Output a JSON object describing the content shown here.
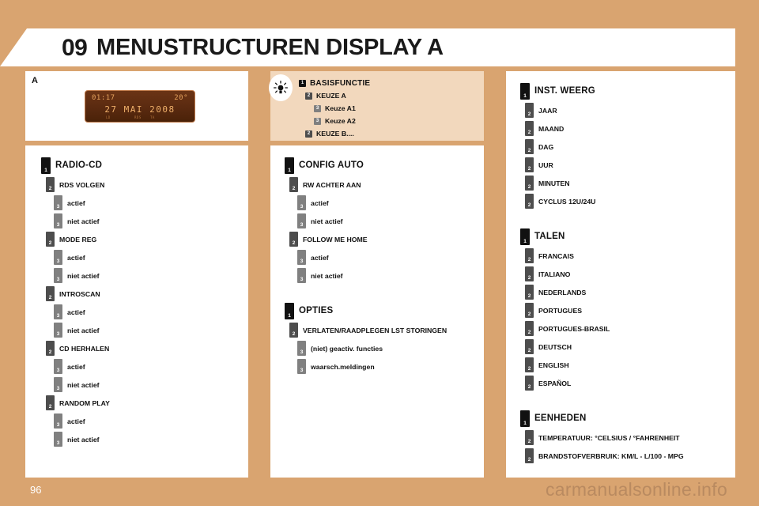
{
  "header": {
    "chapter_number": "09",
    "title": "MENUSTRUCTUREN DISPLAY A"
  },
  "footer": {
    "page_number": "96",
    "watermark": "carmanualsonline.info"
  },
  "display_panel": {
    "letter": "A",
    "lcd": {
      "time": "01:17",
      "temperature": "20°",
      "date": "27 MAI 2008",
      "indicator_1": "LD",
      "indicator_2": "RDS",
      "indicator_3": "TA"
    }
  },
  "legend": {
    "icon": "light-bulb-icon",
    "items": [
      {
        "level": 1,
        "label": "BASISFUNCTIE"
      },
      {
        "level": 2,
        "label": "KEUZE A"
      },
      {
        "level": 3,
        "label": "Keuze A1"
      },
      {
        "level": 3,
        "label": "Keuze A2"
      },
      {
        "level": 2,
        "label": "KEUZE B...."
      }
    ]
  },
  "columns": {
    "left": {
      "sections": [
        {
          "title": "RADIO-CD",
          "items": [
            {
              "level": 2,
              "label": "RDS VOLGEN"
            },
            {
              "level": 3,
              "label": "actief"
            },
            {
              "level": 3,
              "label": "niet actief"
            },
            {
              "level": 2,
              "label": "MODE REG"
            },
            {
              "level": 3,
              "label": "actief"
            },
            {
              "level": 3,
              "label": "niet actief"
            },
            {
              "level": 2,
              "label": "INTROSCAN"
            },
            {
              "level": 3,
              "label": "actief"
            },
            {
              "level": 3,
              "label": "niet actief"
            },
            {
              "level": 2,
              "label": "CD HERHALEN"
            },
            {
              "level": 3,
              "label": "actief"
            },
            {
              "level": 3,
              "label": "niet actief"
            },
            {
              "level": 2,
              "label": "RANDOM PLAY"
            },
            {
              "level": 3,
              "label": "actief"
            },
            {
              "level": 3,
              "label": "niet actief"
            }
          ]
        }
      ]
    },
    "middle": {
      "sections": [
        {
          "title": "CONFIG AUTO",
          "items": [
            {
              "level": 2,
              "label": "RW ACHTER AAN"
            },
            {
              "level": 3,
              "label": "actief"
            },
            {
              "level": 3,
              "label": "niet actief"
            },
            {
              "level": 2,
              "label": "FOLLOW ME HOME"
            },
            {
              "level": 3,
              "label": "actief"
            },
            {
              "level": 3,
              "label": "niet actief"
            }
          ]
        },
        {
          "title": "OPTIES",
          "items": [
            {
              "level": 2,
              "label": "VERLATEN/RAADPLEGEN LST STORINGEN"
            },
            {
              "level": 3,
              "label": "(niet) geactiv. functies"
            },
            {
              "level": 3,
              "label": "waarsch.meldingen"
            }
          ]
        }
      ]
    },
    "right": {
      "sections": [
        {
          "title": "INST. WEERG",
          "items": [
            {
              "level": 2,
              "label": "JAAR"
            },
            {
              "level": 2,
              "label": "MAAND"
            },
            {
              "level": 2,
              "label": "DAG"
            },
            {
              "level": 2,
              "label": "UUR"
            },
            {
              "level": 2,
              "label": "MINUTEN"
            },
            {
              "level": 2,
              "label": "CYCLUS 12U/24U"
            }
          ]
        },
        {
          "title": "TALEN",
          "items": [
            {
              "level": 2,
              "label": "FRANCAIS"
            },
            {
              "level": 2,
              "label": "ITALIANO"
            },
            {
              "level": 2,
              "label": "NEDERLANDS"
            },
            {
              "level": 2,
              "label": "PORTUGUES"
            },
            {
              "level": 2,
              "label": "PORTUGUES-BRASIL"
            },
            {
              "level": 2,
              "label": "DEUTSCH"
            },
            {
              "level": 2,
              "label": "ENGLISH"
            },
            {
              "level": 2,
              "label": "ESPAÑOL"
            }
          ]
        },
        {
          "title": "EENHEDEN",
          "items": [
            {
              "level": 2,
              "label": "TEMPERATUUR: °CELSIUS / °FAHRENHEIT"
            },
            {
              "level": 2,
              "label": "BRANDSTOFVERBRUIK: KM/L - L/100 - MPG"
            }
          ]
        }
      ]
    }
  },
  "badge_numbers": {
    "level1": "1",
    "level2": "2",
    "level3": "3"
  },
  "colors": {
    "page_background": "#d9a470",
    "panel_background": "#ffffff",
    "legend_panel_background": "#f2d8bd",
    "badge_level1": "#111111",
    "badge_level2": "#4d4d4d",
    "badge_level3": "#808080",
    "lcd_text": "#e3a05c"
  }
}
